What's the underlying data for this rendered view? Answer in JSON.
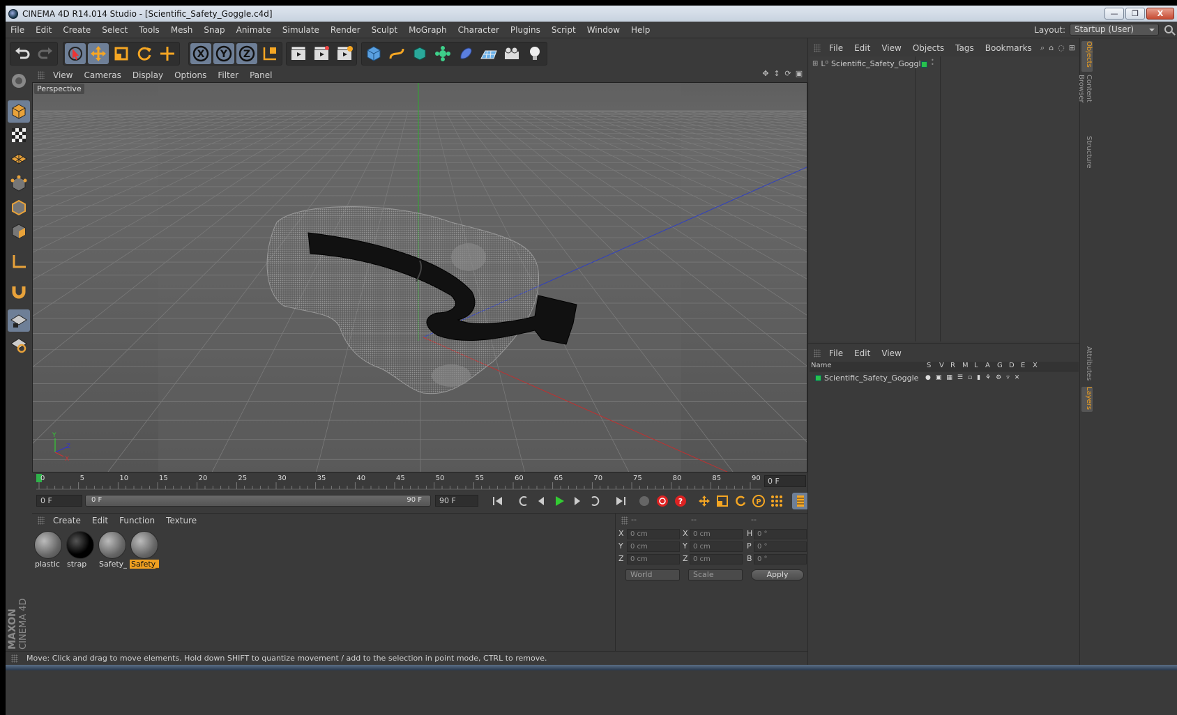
{
  "window": {
    "title": "CINEMA 4D R14.014 Studio - [Scientific_Safety_Goggle.c4d]",
    "controls": [
      "—",
      "❐",
      "X"
    ]
  },
  "menubar": {
    "items": [
      "File",
      "Edit",
      "Create",
      "Select",
      "Tools",
      "Mesh",
      "Snap",
      "Animate",
      "Simulate",
      "Render",
      "Sculpt",
      "MoGraph",
      "Character",
      "Plugins",
      "Script",
      "Window",
      "Help"
    ],
    "layout_label": "Layout:",
    "layout_value": "Startup (User)"
  },
  "toolbar": {
    "icons": [
      "undo-icon",
      "redo-icon",
      "live-selection-icon",
      "move-icon",
      "scale-icon",
      "rotate-icon",
      "add-object-icon",
      "x-axis-icon",
      "y-axis-icon",
      "z-axis-icon",
      "coordinate-system-icon",
      "render-view-icon",
      "render-picture-viewer-icon",
      "render-settings-icon",
      "cube-icon",
      "spline-icon",
      "nurbs-icon",
      "array-icon",
      "deformer-icon",
      "floor-icon",
      "camera-icon",
      "light-icon"
    ]
  },
  "viewport": {
    "menu": [
      "View",
      "Cameras",
      "Display",
      "Options",
      "Filter",
      "Panel"
    ],
    "label": "Perspective",
    "axis_labels": {
      "y": "Y",
      "z": "Z",
      "x": "X"
    }
  },
  "timeline": {
    "ticks": [
      "0",
      "5",
      "10",
      "15",
      "20",
      "25",
      "30",
      "35",
      "40",
      "45",
      "50",
      "55",
      "60",
      "65",
      "70",
      "75",
      "80",
      "85",
      "90"
    ],
    "current_frame": "0 F"
  },
  "transport": {
    "start": "0 F",
    "range_start": "0 F",
    "range_end": "90 F",
    "end": "90 F"
  },
  "materials": {
    "menu": [
      "Create",
      "Edit",
      "Function",
      "Texture"
    ],
    "items": [
      {
        "label": "plastic",
        "kind": "grey"
      },
      {
        "label": "strap",
        "kind": "black"
      },
      {
        "label": "Safety_G",
        "kind": "grey"
      },
      {
        "label": "Safety_G",
        "kind": "grey",
        "selected": true
      }
    ]
  },
  "coordinates": {
    "headers": [
      "--",
      "--",
      "--"
    ],
    "rows": [
      {
        "l1": "X",
        "v1": "0 cm",
        "l2": "X",
        "v2": "0 cm",
        "l3": "H",
        "v3": "0 °"
      },
      {
        "l1": "Y",
        "v1": "0 cm",
        "l2": "Y",
        "v2": "0 cm",
        "l3": "P",
        "v3": "0 °"
      },
      {
        "l1": "Z",
        "v1": "0 cm",
        "l2": "Z",
        "v2": "0 cm",
        "l3": "B",
        "v3": "0 °"
      }
    ],
    "mode": "World",
    "transform": "Scale",
    "apply": "Apply"
  },
  "status": {
    "text": "Move: Click and drag to move elements. Hold down SHIFT to quantize movement / add to the selection in point mode, CTRL to remove."
  },
  "objects_panel": {
    "menu": [
      "File",
      "Edit",
      "View",
      "Objects",
      "Tags",
      "Bookmarks"
    ],
    "object_name": "Scientific_Safety_Goggle",
    "object_color": "#27c24c"
  },
  "layers_panel": {
    "menu": [
      "File",
      "Edit",
      "View"
    ],
    "columns": [
      "Name",
      "S",
      "V",
      "R",
      "M",
      "L",
      "A",
      "G",
      "D",
      "E",
      "X"
    ],
    "layer_name": "Scientific_Safety_Goggle"
  },
  "side_tabs": [
    "Objects",
    "Content Browser",
    "Structure",
    "Attributes",
    "Layers"
  ],
  "brand": {
    "maker": "MAXON",
    "product": "CINEMA 4D"
  },
  "colors": {
    "accent": "#f0a020",
    "active_tool": "#6e7f97",
    "panel": "#3a3a3a"
  }
}
